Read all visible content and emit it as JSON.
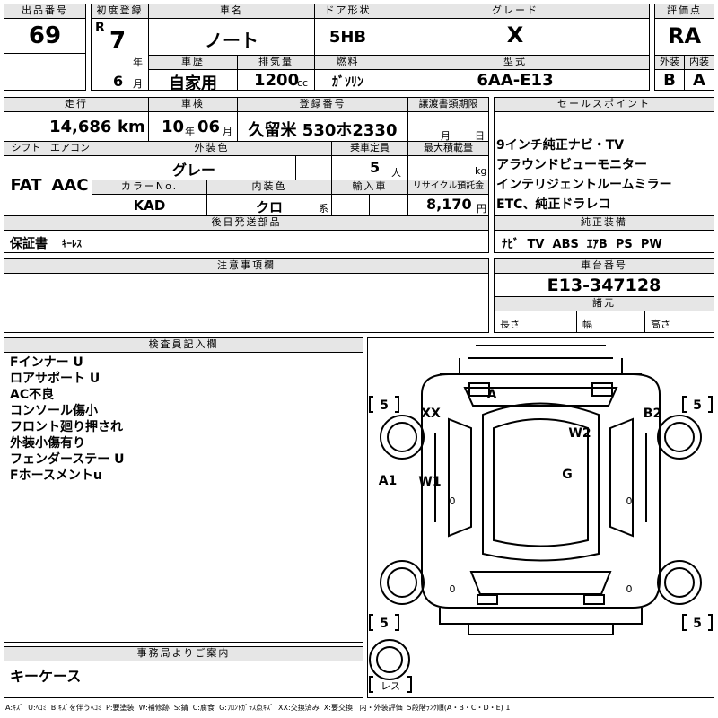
{
  "header": {
    "lot_label": "出品番号",
    "lot": "69",
    "first_reg_label": "初度登録",
    "era": "R",
    "year": "7",
    "year_unit": "年",
    "month": "6",
    "month_unit": "月",
    "car_name_label": "車名",
    "car_name": "ノート",
    "door_label": "ドア形状",
    "door": "5HB",
    "grade_label": "グレード",
    "grade": "X",
    "score_label": "評価点",
    "score": "RA",
    "history_label": "車歴",
    "history": "自家用",
    "displacement_label": "排気量",
    "displacement": "1200",
    "cc": "cc",
    "fuel_label": "燃料",
    "fuel": "ｶﾞｿﾘﾝ",
    "model_label": "型式",
    "model": "6AA-E13",
    "exterior_label": "外装",
    "exterior": "B",
    "interior_label": "内装",
    "interior": "A"
  },
  "row2": {
    "mileage_label": "走行",
    "mileage": "14,686",
    "km": "km",
    "inspection_label": "車検",
    "insp_year": "10",
    "insp_year_unit": "年",
    "insp_month": "06",
    "insp_month_unit": "月",
    "reg_label": "登録番号",
    "reg": "久留米 530ホ2330",
    "transfer_label": "譲渡書類期限",
    "transfer_month": "月",
    "transfer_day": "日",
    "sales_label": "セールスポイント",
    "shift_label": "シフト",
    "shift": "FAT",
    "ac_label": "エアコン",
    "ac": "AAC",
    "color_label": "外装色",
    "color": "グレー",
    "capacity_label": "乗車定員",
    "capacity": "5",
    "capacity_unit": "人",
    "load_label": "最大積載量",
    "load_unit": "kg",
    "color_no_label": "カラーNo.",
    "color_no": "KAD",
    "int_color_label": "内装色",
    "int_color": "クロ",
    "int_color_unit": "系",
    "import_label": "輸入車",
    "recycle_label": "リサイクル預託金",
    "recycle": "8,170",
    "recycle_unit": "円"
  },
  "sales_points": [
    "9インチ純正ナビ・TV",
    "アラウンドビューモニター",
    "インテリジェントルームミラー",
    "ETC、純正ドラレコ"
  ],
  "later_parts": {
    "label": "後日発送部品",
    "value_main": "保証書",
    "value_sub": "ｷｰﾚｽ"
  },
  "equipment": {
    "label": "純正装備",
    "value": "ﾅﾋﾞ  TV  ABS  ｴｱB  PS  PW"
  },
  "caution": {
    "label": "注意事項欄"
  },
  "chassis": {
    "label": "車台番号",
    "value": "E13-347128",
    "dims_label": "諸元",
    "length": "長さ",
    "width": "幅",
    "height": "高さ"
  },
  "inspector": {
    "label": "検査員記入欄",
    "notes": [
      "Fインナー U",
      "ロアサポート U",
      "AC不良",
      "コンソール傷小",
      "フロント廻り押され",
      "外装小傷有り",
      "フェンダーステー U",
      "Fホースメントu"
    ]
  },
  "office": {
    "label": "事務局よりご案内",
    "value": "キーケース"
  },
  "diagram": {
    "marks": [
      "A",
      "XX",
      "B2",
      "W2",
      "G",
      "A1",
      "W1"
    ],
    "tire_fl": "5",
    "tire_fr": "5",
    "tire_rl": "5",
    "tire_rr": "5",
    "spare": "レス",
    "panel_marks": [
      "0",
      "0",
      "0",
      "0"
    ]
  },
  "legend": "A:ｷｽﾞ  U:ﾍｺﾐ  B:ｷｽﾞを伴うﾍｺﾐ  P:要塗装  W:補修跡  S:錆  C:腐食  G:ﾌﾛﾝﾄｶﾞﾗｽ点ｷｽﾞ  XX:交換済み  X:要交換   内・外装評価  5段階ﾗﾝｸ順(A・B・C・D・E) 1"
}
